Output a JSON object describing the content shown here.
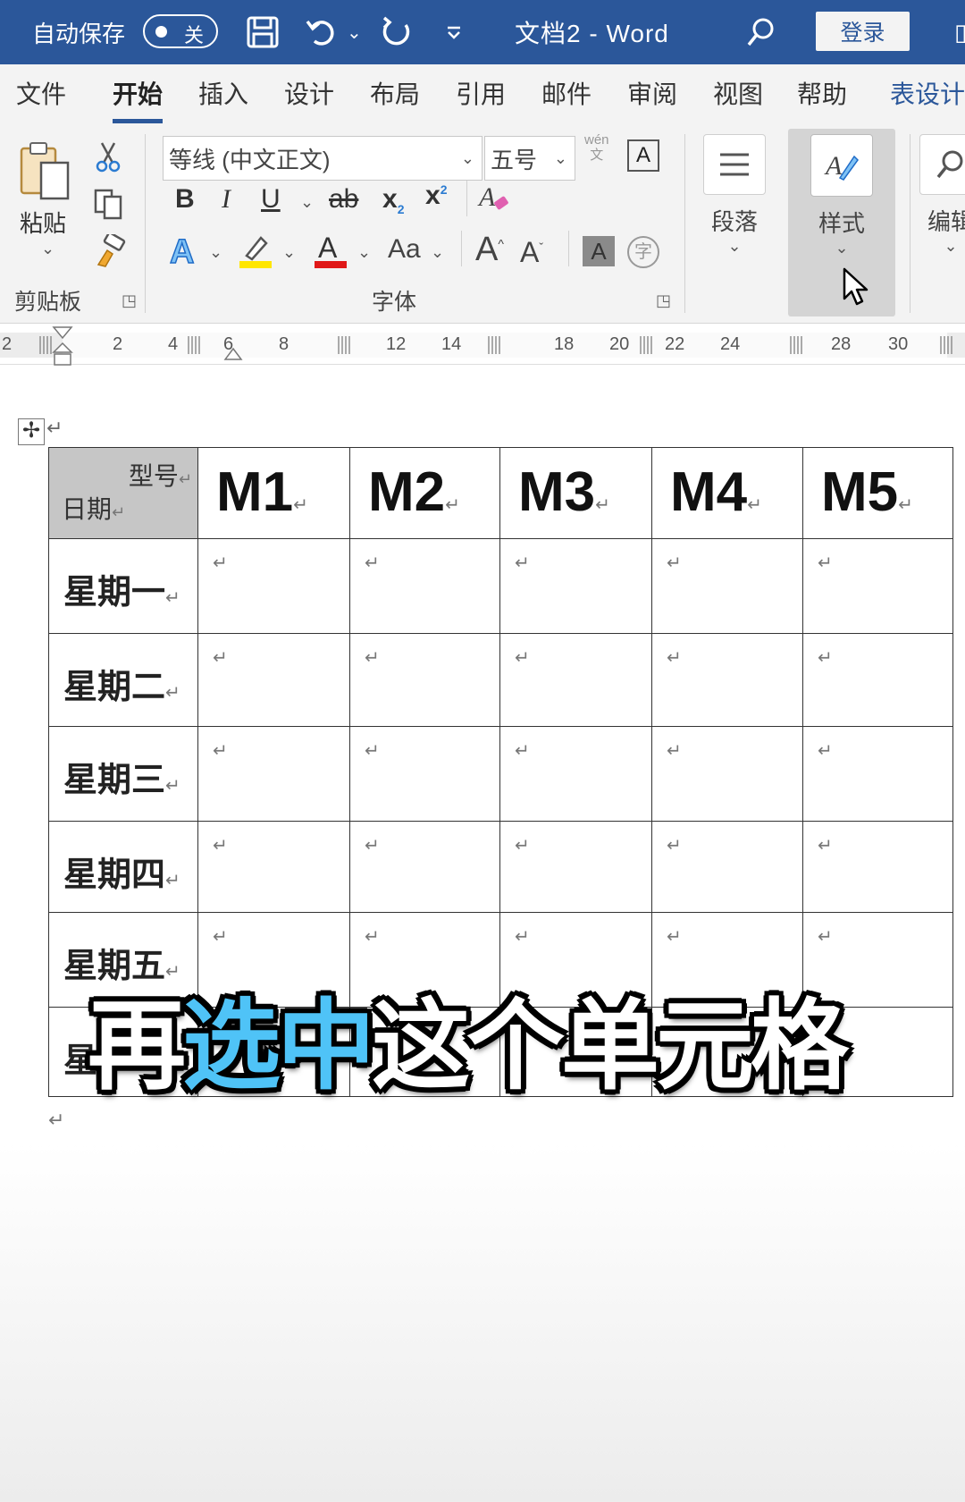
{
  "titlebar": {
    "autosave_label": "自动保存",
    "autosave_toggle": "关",
    "doc_title": "文档2  -  Word",
    "login": "登录",
    "bg_color": "#2b579a"
  },
  "tabs": [
    {
      "label": "文件"
    },
    {
      "label": "开始"
    },
    {
      "label": "插入"
    },
    {
      "label": "设计"
    },
    {
      "label": "布局"
    },
    {
      "label": "引用"
    },
    {
      "label": "邮件"
    },
    {
      "label": "审阅"
    },
    {
      "label": "视图"
    },
    {
      "label": "帮助"
    },
    {
      "label": "表设计"
    }
  ],
  "ribbon": {
    "clipboard": {
      "paste": "粘贴",
      "group": "剪贴板"
    },
    "font": {
      "name": "等线 (中文正文)",
      "size": "五号",
      "group": "字体",
      "phonetic_top": "wén",
      "phonetic_bottom": "文",
      "bold": "B",
      "italic": "I",
      "underline": "U",
      "strike": "ab",
      "subscript": "x",
      "superscript": "x",
      "font_color": "A",
      "change_case": "Aa",
      "grow": "A",
      "shrink": "A",
      "shading": "A",
      "enclose": "字"
    },
    "paragraph": {
      "label": "段落"
    },
    "styles": {
      "label": "样式"
    },
    "editing": {
      "label": "编辑"
    }
  },
  "ruler": {
    "numbers": [
      "2",
      "2",
      "4",
      "6",
      "8",
      "12",
      "14",
      "18",
      "20",
      "22",
      "24",
      "28",
      "30"
    ]
  },
  "table": {
    "header": {
      "top": "型号",
      "bottom": "日期"
    },
    "models": [
      "M1",
      "M2",
      "M3",
      "M4",
      "M5"
    ],
    "days": [
      "星期一",
      "星期二",
      "星期三",
      "星期四",
      "星期五",
      "星"
    ]
  },
  "caption": {
    "part1": "再",
    "part2": "选中",
    "part3": "这个单元格"
  },
  "colors": {
    "caption_highlight": "#4fc3f7",
    "header_cell": "#c6c6c6"
  }
}
